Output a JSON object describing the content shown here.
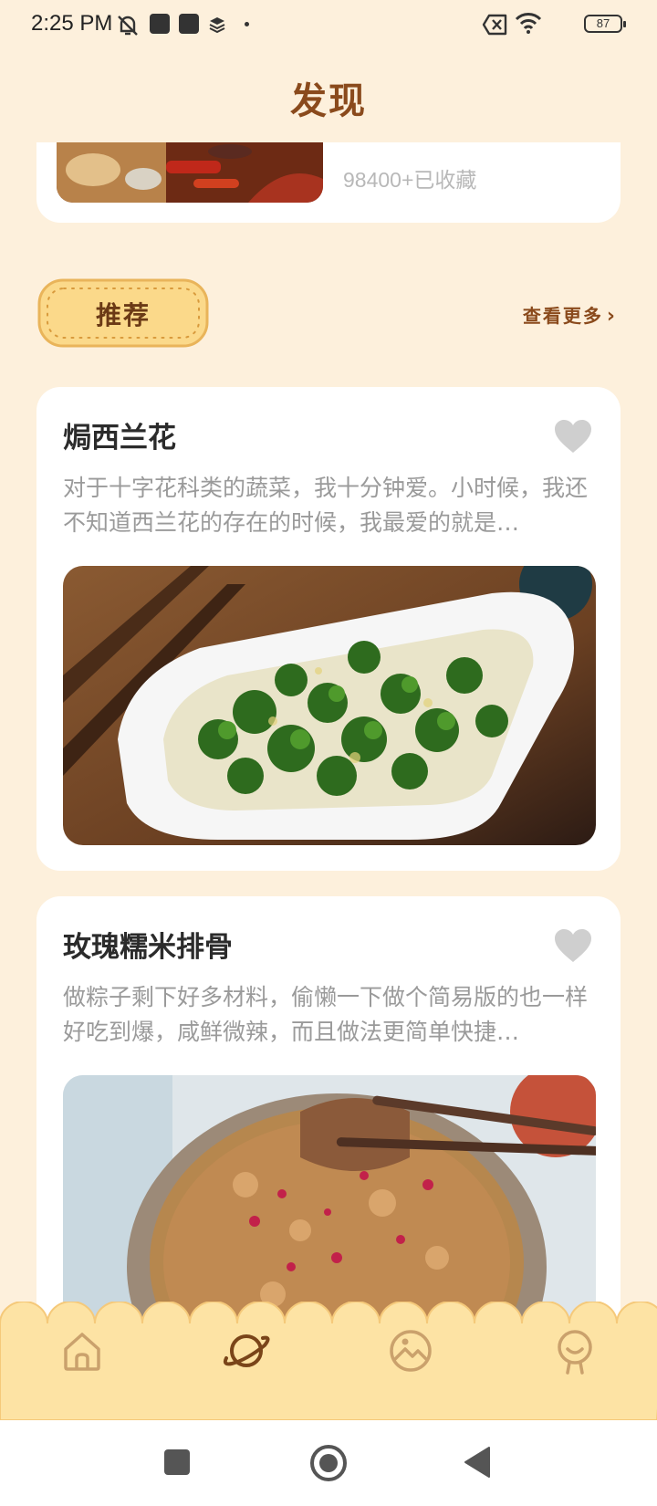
{
  "status_bar": {
    "time": "2:25 PM",
    "battery": "87",
    "icons": [
      "mute-icon",
      "notification-icon",
      "notification-icon",
      "layers-icon",
      "dot-icon",
      "sim-off-icon",
      "wifi-icon",
      "battery-icon"
    ]
  },
  "header": {
    "title": "发现"
  },
  "top_card": {
    "favorites": "98400+已收藏"
  },
  "section": {
    "badge": "推荐",
    "see_more": "查看更多",
    "see_more_icon": "chevron-right-icon"
  },
  "recipes": [
    {
      "title": "焗西兰花",
      "description": "对于十字花科类的蔬菜，我十分钟爱。小时候，我还不知道西兰花的存在的时候，我最爱的就是…",
      "icon": "heart-icon"
    },
    {
      "title": "玫瑰糯米排骨",
      "description": "做粽子剩下好多材料，偷懒一下做个简易版的也一样好吃到爆，咸鲜微辣，而且做法更简单快捷…",
      "icon": "heart-icon"
    }
  ],
  "bottom_nav": {
    "items": [
      {
        "icon": "home-icon",
        "active": false
      },
      {
        "icon": "planet-icon",
        "active": true
      },
      {
        "icon": "gallery-icon",
        "active": false
      },
      {
        "icon": "profile-icon",
        "active": false
      }
    ]
  },
  "system_nav": {
    "icons": [
      "recents-icon",
      "home-circle-icon",
      "back-icon"
    ]
  },
  "colors": {
    "background": "#fdf0dc",
    "title_brown": "#8a4a1c",
    "badge_yellow": "#fbd98a",
    "nav_bg": "#fde3a4",
    "icon_inactive": "#caa16c",
    "icon_active": "#7a4519",
    "heart_gray": "#cfcfcf"
  }
}
